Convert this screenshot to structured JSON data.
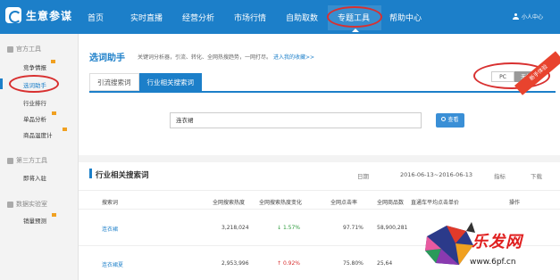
{
  "brand": {
    "name": "生意参谋"
  },
  "nav": {
    "items": [
      "首页",
      "实时直播",
      "经营分析",
      "市场行情",
      "自助取数",
      "专题工具",
      "帮助中心"
    ],
    "active": "专题工具",
    "user": "小人中心"
  },
  "sidebar": {
    "groups": [
      {
        "label": "官方工具",
        "items": [
          "竞争情报",
          "选词助手",
          "行业排行",
          "单品分析",
          "商品温度计"
        ]
      },
      {
        "label": "第三方工具",
        "items": [
          "即将入驻"
        ]
      },
      {
        "label": "数据实验室",
        "items": [
          "销量预测"
        ]
      }
    ],
    "active": "选词助手"
  },
  "page": {
    "title": "选词助手",
    "subtitle": "关键词分析器，引流、转化、全网热搜趋势，一网打尽。",
    "subtitle_link": "进入我的收藏>>",
    "tabs": [
      "引流搜索词",
      "行业相关搜索词"
    ],
    "active_tab": "行业相关搜索词",
    "device": {
      "options": [
        "PC",
        "无线"
      ],
      "selected": "无线"
    },
    "ribbon": "新手体验"
  },
  "search": {
    "value": "连衣裙",
    "button": "查看"
  },
  "section": {
    "title": "行业相关搜索词",
    "date_label": "日期",
    "date_range": "2016-06-13~2016-06-13",
    "metric_label": "指标",
    "download_label": "下载"
  },
  "table": {
    "headers": [
      "搜索词",
      "全网搜索热度",
      "全网搜索热度变化",
      "全网点击率",
      "全网商品数",
      "直通车平均点击单价",
      "操作"
    ],
    "rows": [
      {
        "keyword": "连衣裙",
        "heat": "3,218,024",
        "change": "1.57%",
        "change_dir": "down",
        "ctr": "97.71%",
        "items": "58,900,281"
      },
      {
        "keyword": "连衣裙夏",
        "heat": "2,953,996",
        "change": "0.92%",
        "change_dir": "up",
        "ctr": "75.80%",
        "items": "25,64"
      }
    ]
  },
  "watermark": {
    "text": "乐发网",
    "url": "www.6pf.cn"
  },
  "colors": {
    "primary": "#1c7fc9",
    "highlight": "#d83030",
    "ribbon": "#e8432e"
  }
}
